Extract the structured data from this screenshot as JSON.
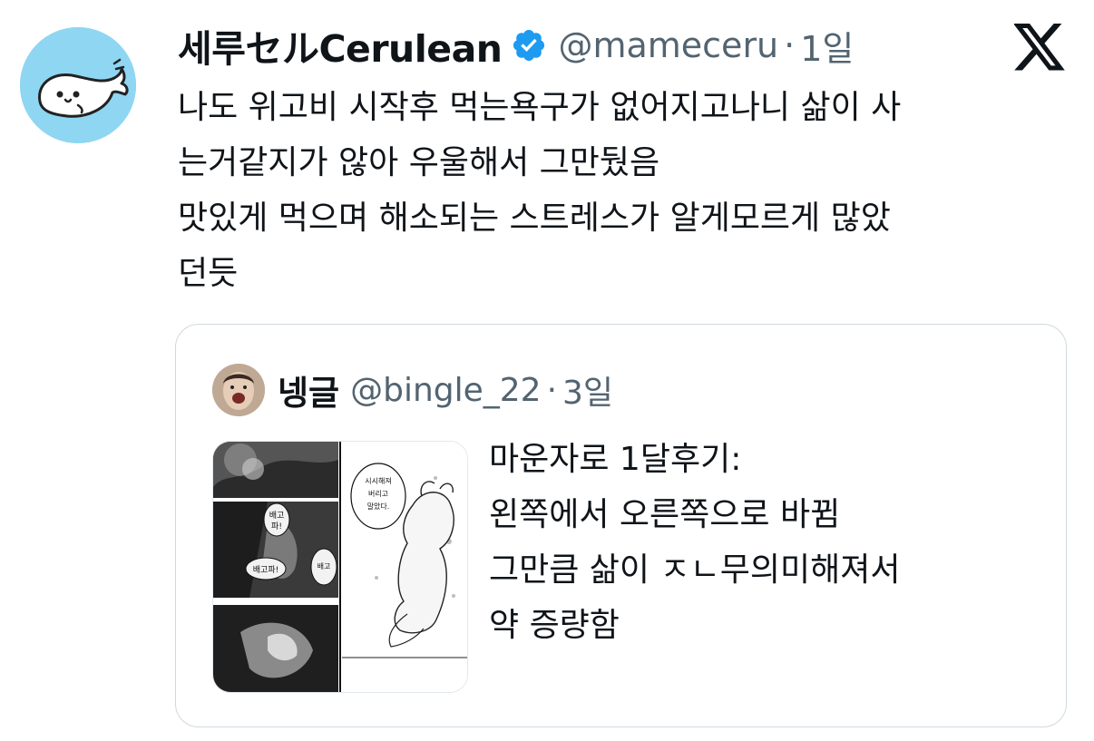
{
  "tweet": {
    "author": {
      "display_name": "세루セルCerulean",
      "handle": "@mameceru",
      "time": "1일",
      "verified": true,
      "avatar_icon": "seal-avatar-icon"
    },
    "text_lines": [
      "나도 위고비 시작후 먹는욕구가 없어지고나니 삶이 사",
      "는거같지가 않아 우울해서 그만뒀음",
      "맛있게 먹으며 해소되는 스트레스가 알게모르게 많았",
      "던듯"
    ],
    "platform_icon": "x-logo-icon"
  },
  "quote": {
    "author": {
      "display_name": "넹글",
      "handle": "@bingle_22",
      "time": "3일"
    },
    "media": {
      "description_icon": "manga-panel-image",
      "bubble_1": [
        "배고",
        "파!"
      ],
      "bubble_2": "배고파!",
      "bubble_3": "배고",
      "bubble_4": [
        "시시해져",
        "버리고",
        "말았다."
      ]
    },
    "text_lines": [
      "마운자로 1달후기:",
      "왼쪽에서 오른쪽으로 바뀜",
      "그만큼 삶이 ㅈㄴ무의미해져서",
      "약 증량함"
    ]
  },
  "colors": {
    "text_primary": "#0f1419",
    "text_secondary": "#536471",
    "verified_blue": "#1d9bf0",
    "avatar_bg": "#8fd6f3",
    "border": "#cfd9de"
  }
}
